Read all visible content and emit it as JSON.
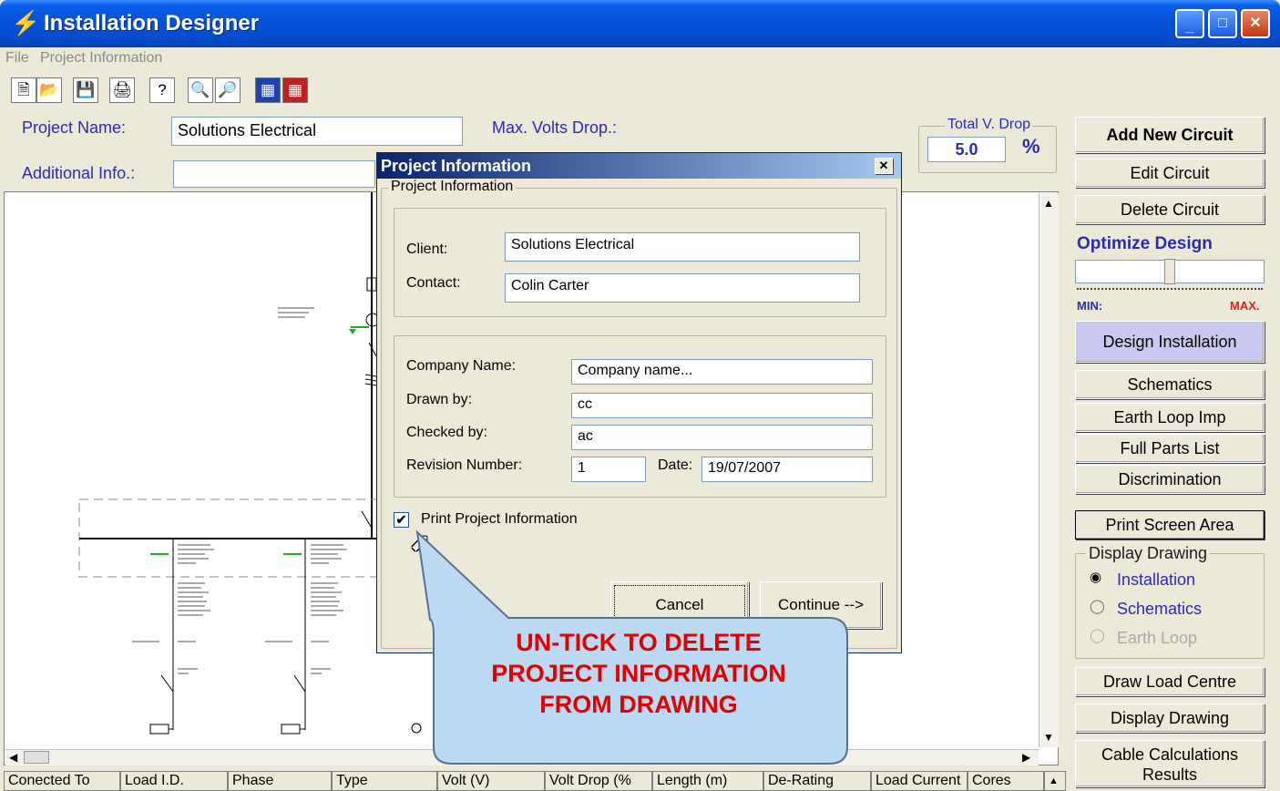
{
  "window": {
    "title": "Installation Designer"
  },
  "menu": [
    "File",
    "Project Information"
  ],
  "project": {
    "name_label": "Project Name:",
    "name_value": "Solutions Electrical",
    "additional_label": "Additional Info.:",
    "additional_value": "",
    "max_volts_label": "Max. Volts Drop.:",
    "total_vdrop_label": "Total V. Drop",
    "total_vdrop_value": "5.0",
    "total_vdrop_unit": "%"
  },
  "right_panel": {
    "add_circuit": "Add New Circuit",
    "edit_circuit": "Edit Circuit",
    "delete_circuit": "Delete Circuit",
    "optimize": "Optimize Design",
    "min": "MIN:",
    "max": "MAX.",
    "optimize_level_percent": 50,
    "design_installation": "Design Installation",
    "schematics": "Schematics",
    "earth_loop": "Earth Loop Imp",
    "full_parts": "Full Parts List",
    "discrimination": "Discrimination",
    "print_screen": "Print Screen Area",
    "display_drawing_group": "Display Drawing",
    "radio_installation": "Installation",
    "radio_schematics": "Schematics",
    "radio_earth_loop": "Earth Loop",
    "draw_load_centre": "Draw Load Centre",
    "display_drawing_btn": "Display Drawing",
    "cable_calc_line1": "Cable Calculations",
    "cable_calc_line2": "Results"
  },
  "table_headers": [
    "Conected To",
    "Load I.D.",
    "Phase",
    "Type",
    "Volt (V)",
    "Volt Drop (%",
    "Length (m)",
    "De-Rating",
    "Load Current",
    "Cores"
  ],
  "dialog": {
    "title": "Project Information",
    "group": "Project Information",
    "client_label": "Client:",
    "client_value": "Solutions Electrical",
    "contact_label": "Contact:",
    "contact_value": "Colin Carter",
    "company_label": "Company Name:",
    "company_value": "Company name...",
    "drawn_label": "Drawn by:",
    "drawn_value": "cc",
    "checked_label": "Checked by:",
    "checked_value": "ac",
    "revision_label": "Revision Number:",
    "revision_value": "1",
    "date_label": "Date:",
    "date_value": "19/07/2007",
    "print_label": "Print Project Information",
    "cancel": "Cancel",
    "continue": "Continue -->"
  },
  "callout": {
    "line1": "UN-TICK TO DELETE",
    "line2": "PROJECT INFORMATION",
    "line3": "FROM DRAWING"
  },
  "colors": {
    "title_blue": "#0451d6",
    "callout_red": "#e00000",
    "callout_fill": "#bcd9f4",
    "design_btn": "#c8c8f0"
  }
}
